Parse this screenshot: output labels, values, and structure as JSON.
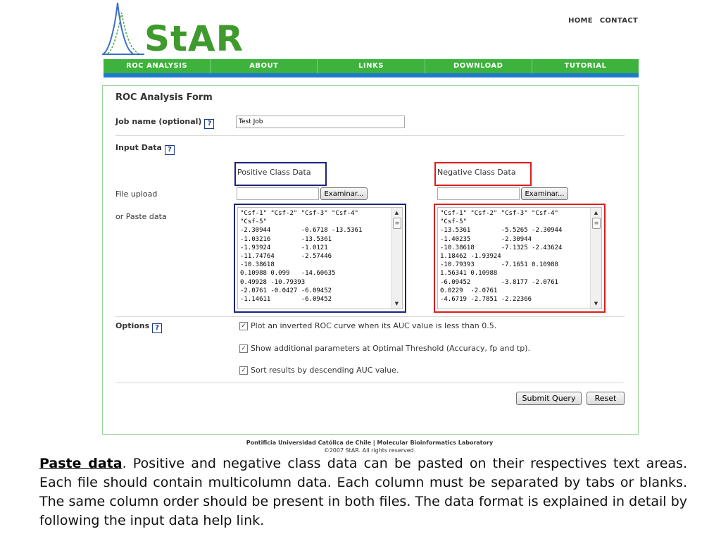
{
  "header": {
    "logo_text": "StAR",
    "top_links": [
      "HOME",
      "CONTACT"
    ]
  },
  "nav": [
    "ROC ANALYSIS",
    "ABOUT",
    "LINKS",
    "DOWNLOAD",
    "TUTORIAL"
  ],
  "form": {
    "title": "ROC Analysis Form",
    "job_label": "Job name (optional)",
    "job_value": "Test Job",
    "help_glyph": "?",
    "input_data_label": "Input Data",
    "positive_label": "Positive Class Data",
    "negative_label": "Negative Class Data",
    "file_upload_label": "File upload",
    "browse_label": "Examinar...",
    "paste_label": "or Paste data",
    "positive_data": "\"Csf-1\" \"Csf-2\" \"Csf-3\" \"Csf-4\"\n\"Csf-5\"\n-2.30944        -0.6718 -13.5361\n-1.03216        -13.5361\n-1.93924        -1.0121\n-11.74764       -2.57446\n-10.38618\n0.10988 0.099   -14.60635\n0.49928 -10.79393\n-2.0761 -0.0427 -6.09452\n-1.14611        -6.09452",
    "negative_data": "\"Csf-1\" \"Csf-2\" \"Csf-3\" \"Csf-4\"\n\"Csf-5\"\n-13.5361        -5.5265 -2.30944\n-1.40235        -2.30944\n-10.38618       -7.1325 -2.43624\n1.18462 -1.93924\n-10.79393       -7.1651 0.10988\n1.56341 0.10988\n-6.09452        -3.8177 -2.0761\n0.0229  -2.0761\n-4.6719 -2.7851 -2.22366",
    "options_label": "Options",
    "options": [
      "Plot an inverted ROC curve when its AUC value is less than 0.5.",
      "Show additional parameters at Optimal Threshold (Accuracy, fp and tp).",
      "Sort results by descending AUC value."
    ],
    "check_glyph": "✓",
    "submit_label": "Submit Query",
    "reset_label": "Reset"
  },
  "footer": {
    "line1": "Pontificia Universidad Católica de Chile  |  Molecular Bioinformatics Laboratory",
    "line2": "©2007 StAR. All rights reserved."
  },
  "caption": {
    "lead": "Paste data",
    "text": ". Positive and negative class data can be pasted on their respectives text areas. Each file should contain multicolumn data. Each column must be separated by tabs or blanks. The same column order should be present in both files. The data format is explained in detail by following the input data help link."
  },
  "colors": {
    "nav_green": "#3db23d",
    "nav_blue_bar": "#1c7ad1",
    "positive_box": "#1a237e",
    "negative_box": "#e01b1b",
    "panel_border": "#9bd19b"
  }
}
